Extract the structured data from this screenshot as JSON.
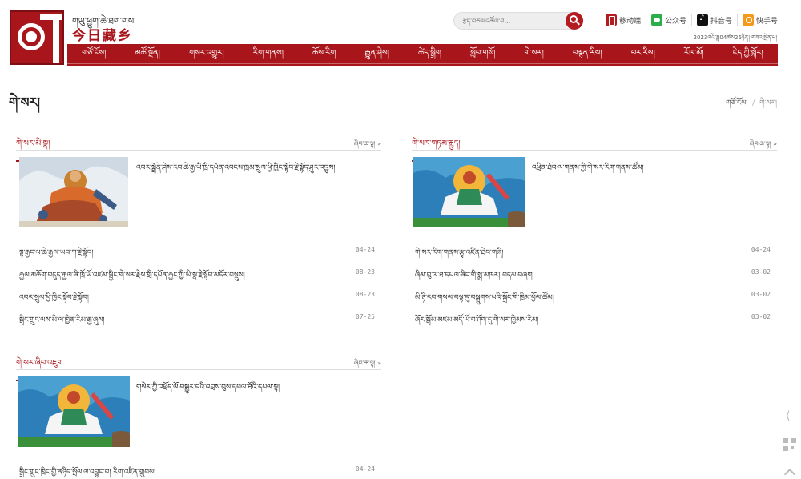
{
  "header": {
    "logo_top": "གཡུ་ཕྱུག་ཆེ་ཐག་གས།",
    "logo_main": "今日藏乡",
    "search_placeholder": "རྩད་བཙལ་འཚོལ་བ...",
    "quick_links": [
      {
        "label": "移动端",
        "icon": "mobile-icon"
      },
      {
        "label": "公众号",
        "icon": "wechat-icon"
      },
      {
        "label": "抖音号",
        "icon": "douyin-icon"
      },
      {
        "label": "快手号",
        "icon": "kuaishou-icon"
      }
    ],
    "date": "2023ལོའི་ཟླ04ཚེས26ཉིན། གཟའ་སྤེན་པ།"
  },
  "nav": [
    "གཙོ་ངོས།",
    "མཚོ་སྔོན།",
    "གསར་འགྱུར།",
    "རིག་གནས།",
    "ཆོས་རིག",
    "རྒྱུན་ཤེས།",
    "ཚེད་སྒྲིག",
    "སློབ་གསོ།",
    "གེ་སར།",
    "བརྙན་རིས།",
    "པར་རིས།",
    "རོལ་མོ།",
    "ངེད་ཀྱི་སྐོར།"
  ],
  "page": {
    "title": "གེ་སར།",
    "breadcrumb": {
      "home": "གཙོ་ངོས།",
      "sep": "/",
      "current": "གེ་སར།"
    }
  },
  "sections": [
    {
      "title": "གེ་སར་མི་སྣ།",
      "more": "ཞིབ་ཆ་ལྟ། »",
      "feature_title": "འབར་སྒྲོན་ཤེས་རབ་ཆེ་རྒྱ་ཡི་ཁྲི་དཔོན་འབངས་ཁྲམ་སྲུལ་ཕྱི་ཁྱིང་སྟོབ་རྗེ་སྟོད་ཤུར་འབྱུས།",
      "items": [
        {
          "title": "སྟ་རྒྱང་ལ་ཆེ་རྒྱལ་ཡབ་ཀ་རྗེ་སྟོབ།",
          "date": "04-24"
        },
        {
          "title": "རྒྱལ་མཆོག་བདུད་རྒྱལ་ཞི་ཁྲོ་ཡོ་འཛམ་སྦྱིང་གེ་སར་རྗེས་གྲི་དཔོན་རྒྱང་ཀྱི་ཡི་སྣ་རྗེ་སྟོབ་མདོར་བསྡུས།",
          "date": "08-23"
        },
        {
          "title": "འབར་སྲུལ་ཕྱི་ཁྱིང་སྟོབ་རྗེ་སྟོབ།",
          "date": "08-23"
        },
        {
          "title": "སྒྲིང་གྲུང་ལས་མི་ལ་ཁྱིན་རིམ་རྒྱ་ཞུས།",
          "date": "07-25"
        }
      ]
    },
    {
      "title": "གེ་སར་གཏམ་རྒྱུད།",
      "more": "ཞིབ་ཆ་ལྟ། »",
      "feature_title": "འཕྲིན་ཐོབ་ལ་གནས་ཀྱི་གེ་སར་རིག་གནས་ཚོམ།",
      "items": [
        {
          "title": "གེ་སར་རིག་གནས་རྩྭ་འཛིན་ཐེབ་གཞི།",
          "date": "04-24"
        },
        {
          "title": "ཞིམ་བུ་ལ་ཐ་དཔལ་ཞིང་གི་སྨྲ་མཁར། བདམ་བཞག།",
          "date": "03-02"
        },
        {
          "title": "མི་ཉི་རབ་གསལ་བལྟ་དུ་བསྒྲུགས་པའི་སྒྲོང་གི་ཁྲིམ་ཕྱོལ་ཚོམ།",
          "date": "03-02"
        },
        {
          "title": "ཞོར་སྒྲོམ་མཛམ་མདོ་ཡོ་བ་ཤོག་དུ་གེ་སར་ཁྱིམས་རིམ།",
          "date": "03-02"
        }
      ]
    },
    {
      "title": "གེ་སར་ཞིབ་འཇུག",
      "more": "ཞིབ་ཆ་ལྟ། »",
      "feature_title": "གསེར་ཀྱི་འཕྲོད་ལོ་བསྒྱུར་བའི་འབྲས་བུས་དཔལ་ཐོའི་དཔལ་སྟ།",
      "items": [
        {
          "title": "སྒྲིང་གྲུང་ཁྲིང་གྱི་ནཉིད་སྤོལ་ལ་འབྱུང་བ། རིག་འཛིན་གྲུབས།",
          "date": "04-24"
        }
      ]
    }
  ]
}
